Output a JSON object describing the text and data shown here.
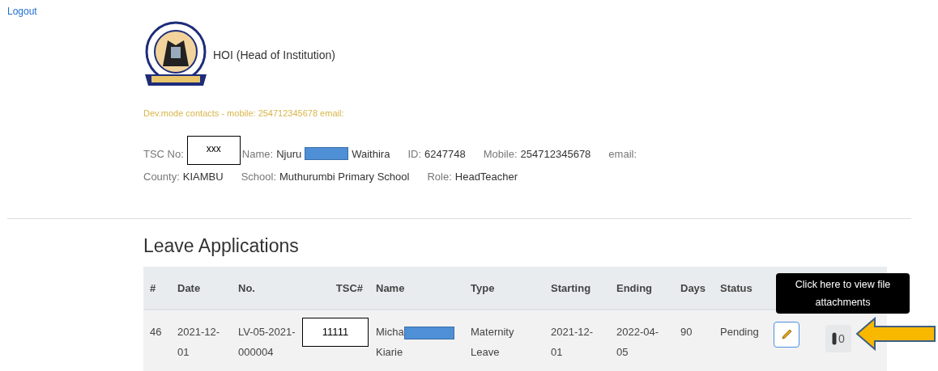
{
  "logout": "Logout",
  "header": {
    "title": "HOI (Head of Institution)"
  },
  "dev_contacts": "Dev.mode contacts - mobile: 254712345678 email:",
  "profile": [
    [
      {
        "kind": "masked",
        "label": "TSC No:",
        "value": "xxx"
      },
      {
        "kind": "redacted",
        "label": "Name:",
        "value": "Njuru",
        "after": "Waithira"
      },
      {
        "kind": "plain",
        "label": "ID:",
        "value": "6247748"
      },
      {
        "kind": "plain",
        "label": "Mobile:",
        "value": "254712345678"
      },
      {
        "kind": "plain",
        "label": "email:"
      }
    ],
    [
      {
        "kind": "plain",
        "label": "County:",
        "value": "KIAMBU"
      },
      {
        "kind": "plain",
        "label": "School:",
        "value": "Muthurumbi Primary School"
      },
      {
        "kind": "plain",
        "label": "Role:",
        "value": "HeadTeacher"
      }
    ]
  ],
  "section_title": "Leave Applications",
  "table": {
    "columns": [
      "#",
      "Date",
      "No.",
      "TSC#",
      "Name",
      "Type",
      "Starting",
      "Ending",
      "Days",
      "Status"
    ],
    "rows": [
      {
        "number": "46",
        "date": "2021-12-01",
        "no": "LV-05-2021-000004",
        "tsc": "11111",
        "name_start": "Micha",
        "name_end": "Kiarie",
        "type": "Maternity Leave",
        "starting": "2021-12-01",
        "ending": "2022-04-05",
        "days": "90",
        "status": "Pending",
        "attachments": "0"
      }
    ]
  },
  "tooltip": "Click here to view file attachments"
}
